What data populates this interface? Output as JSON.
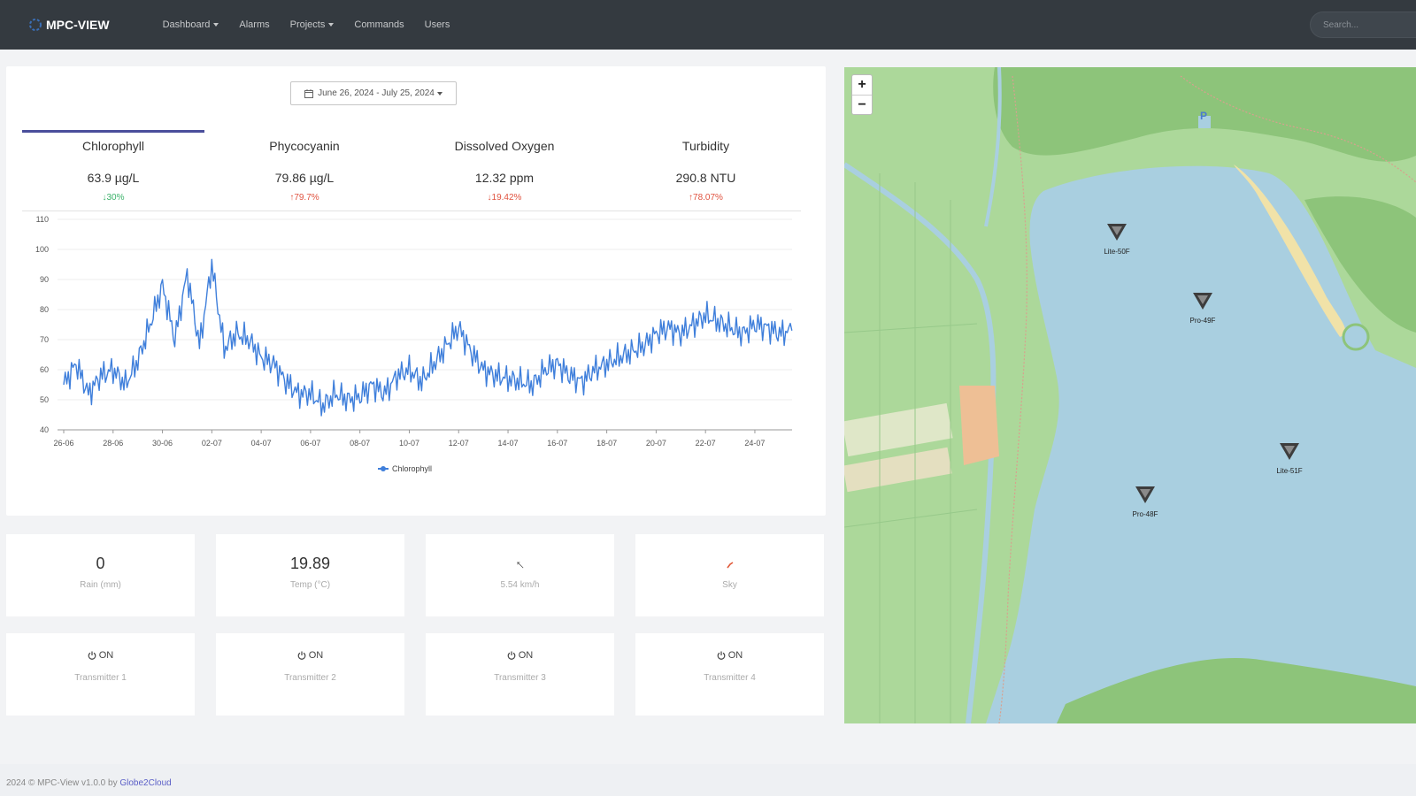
{
  "brand": "MPC-VIEW",
  "nav": {
    "items": [
      "Dashboard",
      "Alarms",
      "Projects",
      "Commands",
      "Users"
    ]
  },
  "search": {
    "placeholder": "Search..."
  },
  "date_range": "June 26, 2024 - July 25, 2024",
  "metrics": [
    {
      "label": "Chlorophyll",
      "value": "63.9 µg/L",
      "delta": "↓30%",
      "direction": "down"
    },
    {
      "label": "Phycocyanin",
      "value": "79.86 µg/L",
      "delta": "↑79.7%",
      "direction": "up"
    },
    {
      "label": "Dissolved Oxygen",
      "value": "12.32 ppm",
      "delta": "↓19.42%",
      "direction": "down"
    },
    {
      "label": "Turbidity",
      "value": "290.8 NTU",
      "delta": "↑78.07%",
      "direction": "up"
    }
  ],
  "chart_data": {
    "type": "line",
    "title": "",
    "xlabel": "",
    "ylabel": "",
    "ylim": [
      40,
      110
    ],
    "yticks": [
      40,
      50,
      60,
      70,
      80,
      90,
      100,
      110
    ],
    "xticks": [
      "26-06",
      "28-06",
      "30-06",
      "02-07",
      "04-07",
      "06-07",
      "08-07",
      "10-07",
      "12-07",
      "14-07",
      "16-07",
      "18-07",
      "20-07",
      "22-07",
      "24-07"
    ],
    "grid": true,
    "legend": "bottom",
    "series": [
      {
        "name": "Chlorophyll",
        "color": "#3f7fdb",
        "x_days": [
          0,
          0.5,
          1,
          1.5,
          2,
          2.5,
          3,
          3.5,
          4,
          4.5,
          5,
          5.5,
          6,
          6.5,
          7,
          7.5,
          8,
          8.5,
          9,
          9.5,
          10,
          10.5,
          11,
          11.5,
          12,
          12.5,
          13,
          13.5,
          14,
          14.5,
          15,
          15.5,
          16,
          16.5,
          17,
          17.5,
          18,
          18.5,
          19,
          19.5,
          20,
          20.5,
          21,
          21.5,
          22,
          22.5,
          23,
          23.5,
          24,
          24.5,
          25,
          25.5,
          26,
          26.5,
          27,
          27.5,
          28,
          28.5,
          29,
          29.5
        ],
        "values": [
          55,
          62,
          52,
          58,
          60,
          55,
          63,
          75,
          88,
          70,
          92,
          68,
          95,
          67,
          72,
          70,
          64,
          62,
          56,
          52,
          52,
          48,
          52,
          50,
          51,
          55,
          52,
          58,
          60,
          56,
          62,
          68,
          74,
          66,
          60,
          58,
          57,
          56,
          55,
          60,
          62,
          58,
          56,
          60,
          62,
          64,
          66,
          68,
          72,
          74,
          72,
          75,
          78,
          76,
          74,
          72,
          75,
          74,
          72,
          73
        ]
      }
    ]
  },
  "weather": [
    {
      "value": "0",
      "label": "Rain (mm)"
    },
    {
      "value": "19.89",
      "label": "Temp (°C)"
    },
    {
      "value": "↑",
      "label": "5.54 km/h",
      "icon": "wind-arrow-icon"
    },
    {
      "value": "",
      "label": "Sky",
      "icon": "sky-icon"
    }
  ],
  "transmitters": [
    {
      "status": "ON",
      "label": "Transmitter 1"
    },
    {
      "status": "ON",
      "label": "Transmitter 2"
    },
    {
      "status": "ON",
      "label": "Transmitter 3"
    },
    {
      "status": "ON",
      "label": "Transmitter 4"
    }
  ],
  "map": {
    "zoom_in": "+",
    "zoom_out": "−",
    "markers": [
      "Lite-50F",
      "Pro-49F",
      "Lite-51F",
      "Pro-48F"
    ],
    "parking": "P"
  },
  "footer": {
    "text": "2024 © MPC-View v1.0.0 by ",
    "link": "Globe2Cloud"
  }
}
